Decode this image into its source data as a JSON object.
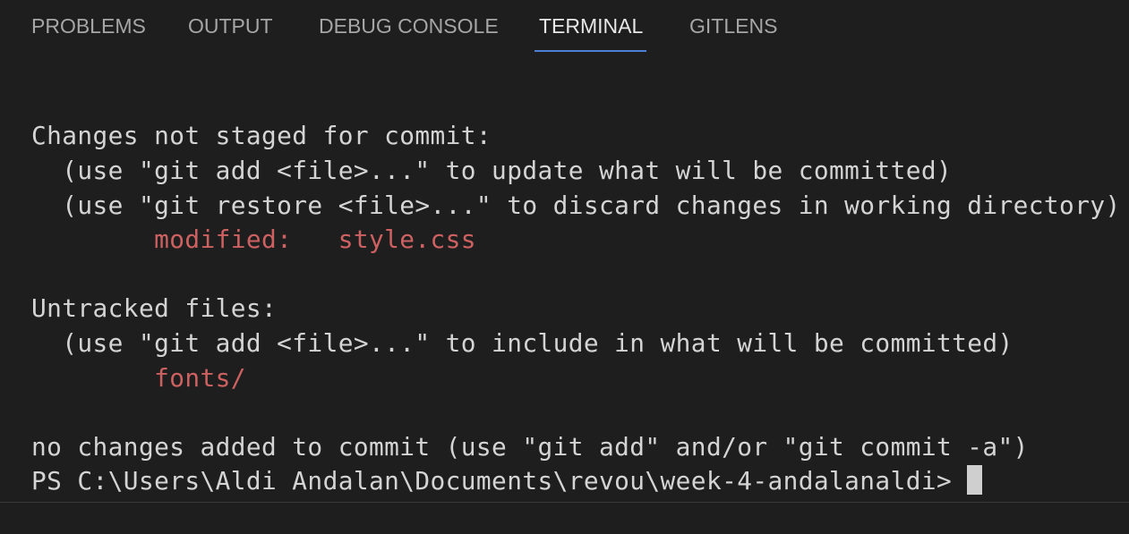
{
  "tabs": [
    {
      "label": "PROBLEMS"
    },
    {
      "label": "OUTPUT"
    },
    {
      "label": "DEBUG CONSOLE"
    },
    {
      "label": "TERMINAL",
      "active": true
    },
    {
      "label": "GITLENS"
    }
  ],
  "terminal": {
    "lines": {
      "changes_header": "Changes not staged for commit:",
      "hint_add_update": "  (use \"git add <file>...\" to update what will be committed)",
      "hint_restore": "  (use \"git restore <file>...\" to discard changes in working directory)",
      "modified_label": "        modified:   ",
      "modified_file": "style.css",
      "untracked_header": "Untracked files:",
      "hint_add_include": "  (use \"git add <file>...\" to include in what will be committed)",
      "untracked_indent": "        ",
      "untracked_file": "fonts/",
      "summary": "no changes added to commit (use \"git add\" and/or \"git commit -a\")",
      "prompt": "PS C:\\Users\\Aldi Andalan\\Documents\\revou\\week-4-andalanaldi> "
    }
  },
  "colors": {
    "background": "#1e1e1e",
    "text": "#d4d4d4",
    "git_modified": "#cd6161",
    "active_tab_underline": "#4d7fd6"
  }
}
